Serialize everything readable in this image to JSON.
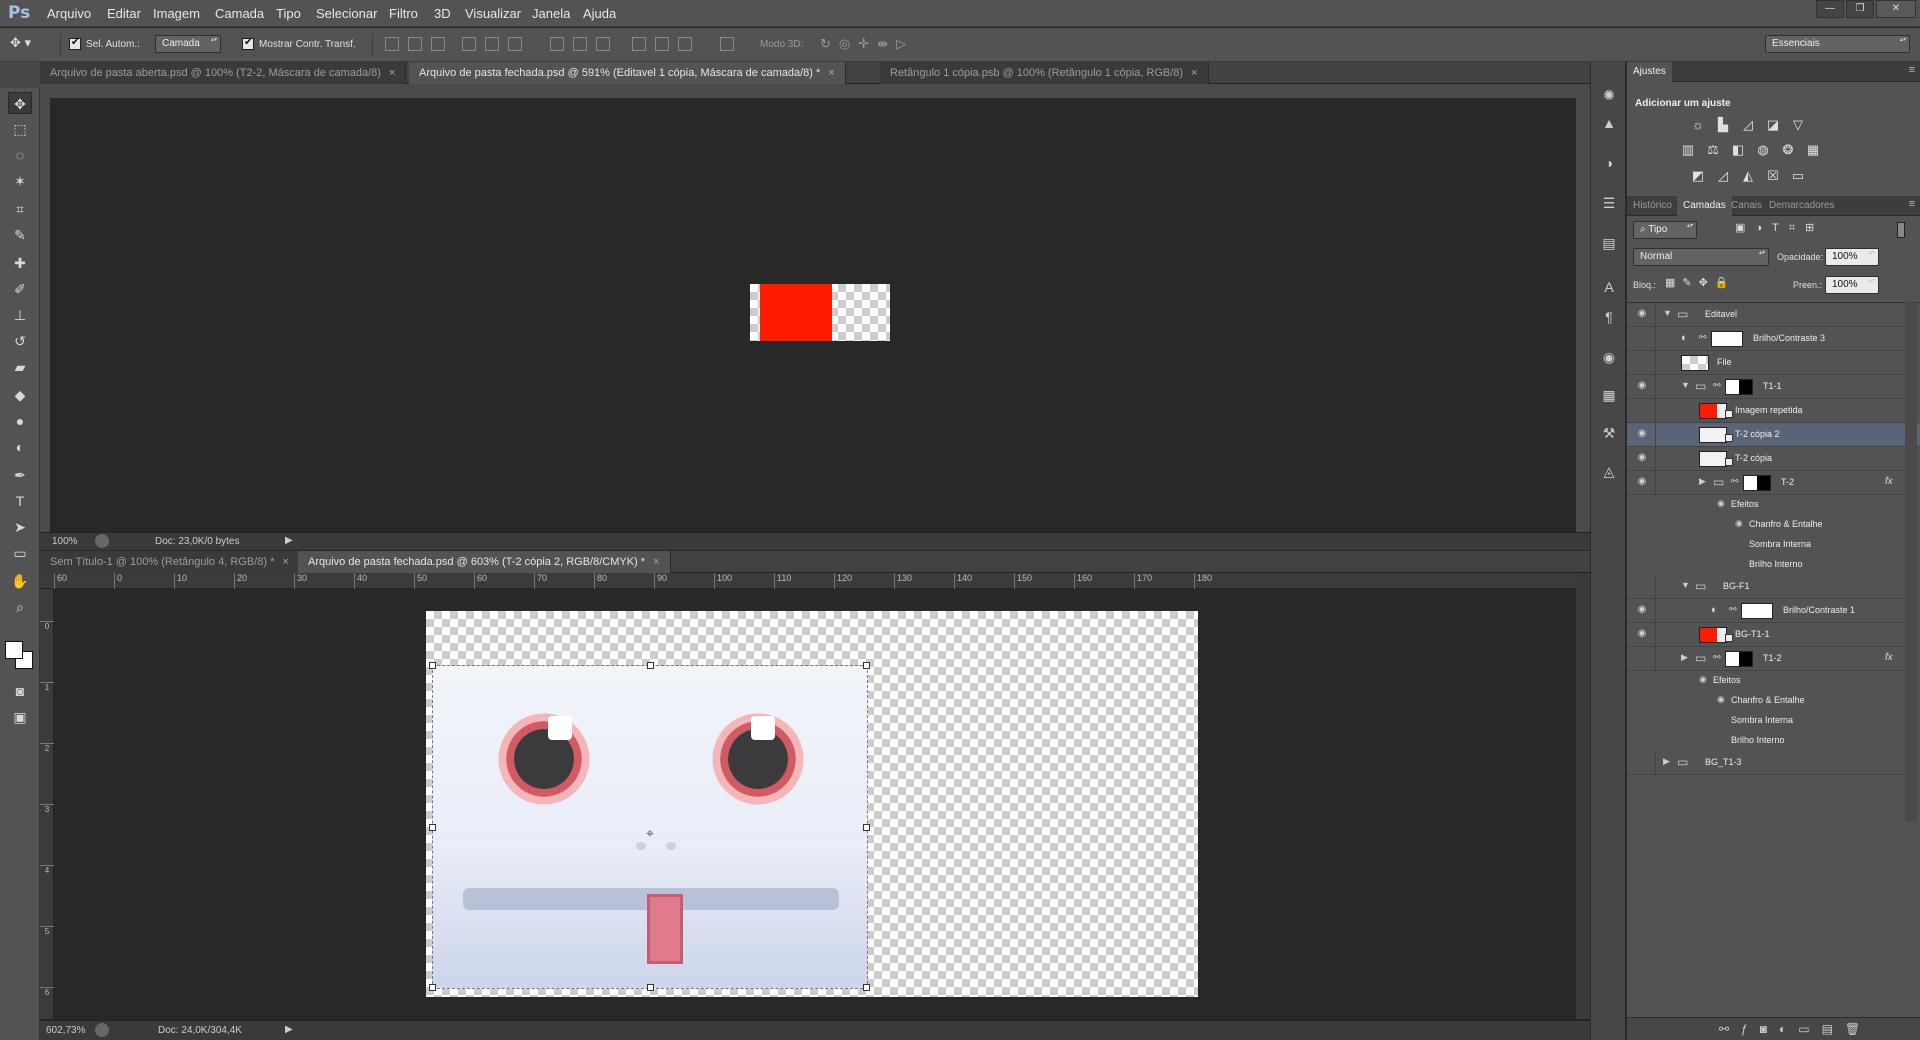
{
  "app": {
    "logo": "Ps"
  },
  "menu": [
    "Arquivo",
    "Editar",
    "Imagem",
    "Camada",
    "Tipo",
    "Selecionar",
    "Filtro",
    "3D",
    "Visualizar",
    "Janela",
    "Ajuda"
  ],
  "options": {
    "sel_autom": "Sel. Autom.:",
    "sel_target": "Camada",
    "mostrar": "Mostrar Contr. Transf.",
    "modo3d": "Modo 3D:",
    "workspace": "Essenciais"
  },
  "top_doc": {
    "tabs": [
      {
        "label": "Arquivo de pasta aberta.psd @ 100% (T2-2, Máscara de camada/8)",
        "active": false
      },
      {
        "label": "Arquivo de pasta fechada.psd @ 591% (Editavel 1 cópia, Máscara de camada/8) *",
        "active": true
      },
      {
        "label": "Retângulo 1 cópia.psb @ 100% (Retângulo 1 cópia, RGB/8)",
        "active": false
      }
    ],
    "zoom": "100%",
    "doc": "Doc: 23,0K/0 bytes",
    "red": "#ff1a00"
  },
  "bottom_doc": {
    "tabs": [
      {
        "label": "Sem Título-1 @ 100% (Retângulo 4, RGB/8) *",
        "active": false
      },
      {
        "label": "Arquivo de pasta fechada.psd @ 603% (T-2 cópia 2, RGB/8/CMYK) *",
        "active": true
      }
    ],
    "zoom": "602,73%",
    "doc": "Doc: 24,0K/304,4K",
    "ruler_h": [
      "60",
      "0",
      "10",
      "20",
      "30",
      "40",
      "50",
      "60",
      "70",
      "80",
      "90",
      "100",
      "110",
      "120",
      "130",
      "140",
      "150",
      "160",
      "170",
      "180"
    ],
    "ruler_v": [
      "0",
      "1",
      "2",
      "3",
      "4",
      "5",
      "6"
    ]
  },
  "panels": {
    "ajustes_tab": "Ajustes",
    "ajustes_title": "Adicionar um ajuste",
    "layer_tabs": [
      "Histórico",
      "Camadas",
      "Canais",
      "Demarcadores"
    ],
    "filter_kind": "Tipo",
    "blend": "Normal",
    "opacity_label": "Opacidade:",
    "opacity": "100%",
    "lock_label": "Bloq.:",
    "fill_label": "Preen.:",
    "fill": "100%",
    "fx": "fx",
    "layers": [
      {
        "name": "Editavel",
        "indent": 0,
        "type": "group-open",
        "eye": true
      },
      {
        "name": "Brilho/Contraste 3",
        "indent": 1,
        "type": "adjustment",
        "eye": false
      },
      {
        "name": "File",
        "indent": 1,
        "type": "checker",
        "eye": false
      },
      {
        "name": "T1-1",
        "indent": 1,
        "type": "group-open-mask",
        "eye": true
      },
      {
        "name": "Imagem repetida",
        "indent": 2,
        "type": "red-smart",
        "eye": false
      },
      {
        "name": "T-2 cópia 2",
        "indent": 2,
        "type": "smart",
        "eye": true,
        "selected": true
      },
      {
        "name": "T-2 cópia",
        "indent": 2,
        "type": "smart",
        "eye": true
      },
      {
        "name": "T-2",
        "indent": 2,
        "type": "group-closed-mask",
        "eye": true,
        "fx": true
      },
      {
        "name": "Efeitos",
        "indent": 3,
        "type": "effect-head",
        "eye": false
      },
      {
        "name": "Chanfro & Entalhe",
        "indent": 4,
        "type": "effect",
        "eye": false
      },
      {
        "name": "Sombra Interna",
        "indent": 4,
        "type": "effect-plain",
        "eye": false
      },
      {
        "name": "Brilho Interno",
        "indent": 4,
        "type": "effect-plain",
        "eye": false
      },
      {
        "name": "BG-F1",
        "indent": 1,
        "type": "group-open",
        "eye": false
      },
      {
        "name": "Brilho/Contraste 1",
        "indent": 2,
        "type": "adjustment-mask",
        "eye": true
      },
      {
        "name": "BG-T1-1",
        "indent": 2,
        "type": "red-smart",
        "eye": true
      },
      {
        "name": "T1-2",
        "indent": 1,
        "type": "group-closed-mask",
        "eye": false,
        "fx": true
      },
      {
        "name": "Efeitos",
        "indent": 2,
        "type": "effect-head",
        "eye": false
      },
      {
        "name": "Chanfro & Entalhe",
        "indent": 3,
        "type": "effect",
        "eye": false
      },
      {
        "name": "Sombra Interna",
        "indent": 3,
        "type": "effect-plain",
        "eye": false
      },
      {
        "name": "Brilho Interno",
        "indent": 3,
        "type": "effect-plain",
        "eye": false
      },
      {
        "name": "BG_T1-3",
        "indent": 0,
        "type": "group-closed",
        "eye": false
      }
    ]
  }
}
